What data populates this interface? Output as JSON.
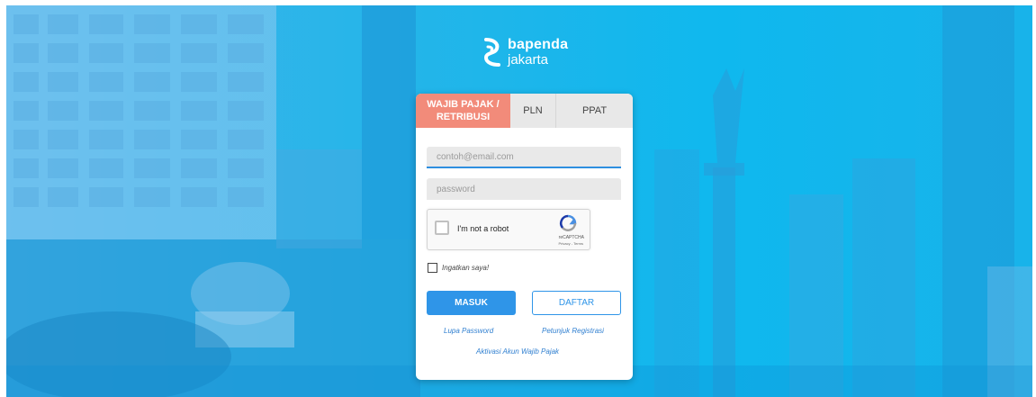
{
  "brand": {
    "name_line1": "bapenda",
    "name_line2": "jakarta"
  },
  "tabs": [
    {
      "label": "WAJIB PAJAK / RETRIBUSI",
      "active": true
    },
    {
      "label": "PLN",
      "active": false
    },
    {
      "label": "PPAT",
      "active": false
    }
  ],
  "form": {
    "email_placeholder": "contoh@email.com",
    "password_placeholder": "password",
    "remember_label": "Ingatkan saya!",
    "login_label": "MASUK",
    "register_label": "DAFTAR"
  },
  "captcha": {
    "label": "I'm not a robot",
    "brand": "reCAPTCHA",
    "links": "Privacy - Terms"
  },
  "links": {
    "forgot_password": "Lupa Password",
    "registration_guide": "Petunjuk Registrasi",
    "activate_account": "Aktivasi Akun Wajib Pajak"
  },
  "colors": {
    "hero": "#23b5e9",
    "active_tab": "#f28b7a",
    "primary": "#2f95e8"
  },
  "icons": {
    "brand_logo": "bapenda-s-logo-icon",
    "captcha_logo": "recaptcha-icon"
  }
}
